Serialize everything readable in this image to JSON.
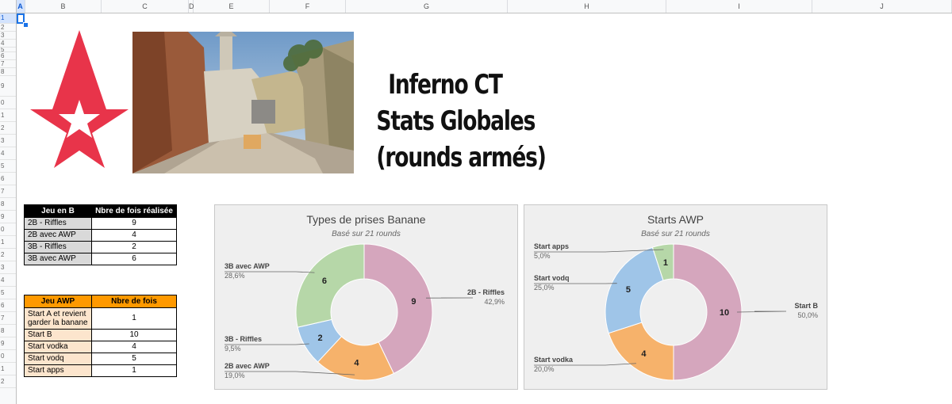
{
  "sheet": {
    "columns": [
      "A",
      "B",
      "C",
      "D",
      "E",
      "F",
      "G",
      "H",
      "I",
      "J"
    ],
    "rows": [
      "1",
      "2",
      "3",
      "4",
      "5",
      "6",
      "7",
      "8",
      "9",
      "0",
      "1",
      "2",
      "3",
      "4",
      "5",
      "6",
      "7",
      "8",
      "9",
      "0",
      "1",
      "2",
      "3",
      "4",
      "5",
      "6",
      "7",
      "8",
      "9",
      "0",
      "1",
      "2"
    ],
    "selected_cell": "A1"
  },
  "logo": {
    "name": "astralis-star-logo",
    "color": "#e8344a"
  },
  "title": {
    "line1": "Inferno CT",
    "line2": "Stats Globales",
    "line3": "(rounds armés)"
  },
  "table_b": {
    "headers": [
      "Jeu en B",
      "Nbre de fois réalisée"
    ],
    "rows": [
      {
        "label": "2B - Riffles",
        "value": "9"
      },
      {
        "label": "2B avec AWP",
        "value": "4"
      },
      {
        "label": "3B - Riffles",
        "value": "2"
      },
      {
        "label": "3B avec AWP",
        "value": "6"
      }
    ],
    "header_bg": "#000000",
    "label_bg": "#d9d9d9"
  },
  "table_awp": {
    "headers": [
      "Jeu AWP",
      "Nbre de fois"
    ],
    "rows": [
      {
        "label1": "Start A et revient",
        "label2": "garder la banane",
        "value": "1"
      },
      {
        "label1": "Start B",
        "value": "10"
      },
      {
        "label1": "Start vodka",
        "value": "4"
      },
      {
        "label1": "Start vodq",
        "value": "5"
      },
      {
        "label1": "Start apps",
        "value": "1"
      }
    ],
    "header_bg": "#ff9900",
    "label_bg": "#fce5cd"
  },
  "chart_data": [
    {
      "type": "pie",
      "title": "Types de prises Banane",
      "subtitle": "Basé sur 21 rounds",
      "donut": true,
      "slices": [
        {
          "name": "2B - Riffles",
          "value": 9,
          "pct": "42,9%",
          "color": "#d5a6bd"
        },
        {
          "name": "2B avec AWP",
          "value": 4,
          "pct": "19,0%",
          "color": "#f6b26b"
        },
        {
          "name": "3B - Riffles",
          "value": 2,
          "pct": "9,5%",
          "color": "#9fc5e8"
        },
        {
          "name": "3B avec AWP",
          "value": 6,
          "pct": "28,6%",
          "color": "#b6d7a8"
        }
      ]
    },
    {
      "type": "pie",
      "title": "Starts AWP",
      "subtitle": "Basé sur 21 rounds",
      "donut": true,
      "slices": [
        {
          "name": "Start B",
          "value": 10,
          "pct": "50,0%",
          "color": "#d5a6bd"
        },
        {
          "name": "Start vodka",
          "value": 4,
          "pct": "20,0%",
          "color": "#f6b26b"
        },
        {
          "name": "Start vodq",
          "value": 5,
          "pct": "25,0%",
          "color": "#9fc5e8"
        },
        {
          "name": "Start apps",
          "value": 1,
          "pct": "5,0%",
          "color": "#b6d7a8"
        }
      ]
    }
  ]
}
